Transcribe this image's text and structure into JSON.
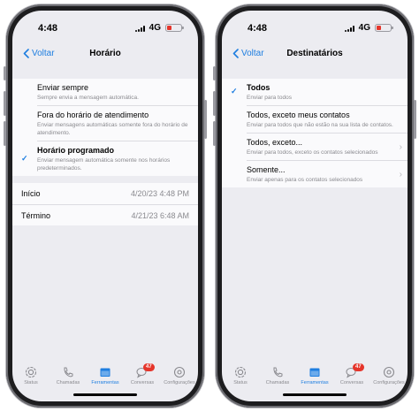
{
  "status_bar": {
    "time": "4:48",
    "network": "4G"
  },
  "screens": [
    {
      "nav": {
        "back_label": "Voltar",
        "title": "Horário"
      },
      "options": [
        {
          "title": "Enviar sempre",
          "subtitle": "Sempre envia a mensagem automática.",
          "selected": false
        },
        {
          "title": "Fora do horário de atendimento",
          "subtitle": "Enviar mensagens automáticas somente fora do horário de atendimento.",
          "selected": false
        },
        {
          "title": "Horário programado",
          "subtitle": "Enviar mensagem automática somente nos horários predeterminados.",
          "selected": true
        }
      ],
      "schedule": [
        {
          "label": "Início",
          "value": "4/20/23 4:48 PM"
        },
        {
          "label": "Término",
          "value": "4/21/23 6:48 AM"
        }
      ]
    },
    {
      "nav": {
        "back_label": "Voltar",
        "title": "Destinatários"
      },
      "options": [
        {
          "title": "Todos",
          "subtitle": "Enviar para todos",
          "selected": true
        },
        {
          "title": "Todos, exceto meus contatos",
          "subtitle": "Enviar para todos que não estão na sua lista de contatos.",
          "selected": false
        },
        {
          "title": "Todos, exceto...",
          "subtitle": "Enviar para todos, exceto os contatos selecionados",
          "selected": false
        },
        {
          "title": "Somente...",
          "subtitle": "Enviar apenas para os contatos selecionados",
          "selected": false
        }
      ]
    }
  ],
  "tabbar": {
    "items": [
      {
        "label": "Status",
        "icon": "status-icon"
      },
      {
        "label": "Chamadas",
        "icon": "phone-icon"
      },
      {
        "label": "Ferramentas",
        "icon": "tools-icon",
        "active": true
      },
      {
        "label": "Conversas",
        "icon": "chat-bubbles-icon",
        "badge": "47"
      },
      {
        "label": "Configurações",
        "icon": "gear-icon"
      }
    ]
  },
  "colors": {
    "accent": "#1e7ee0",
    "badge": "#e5352b",
    "background": "#ececf1"
  }
}
